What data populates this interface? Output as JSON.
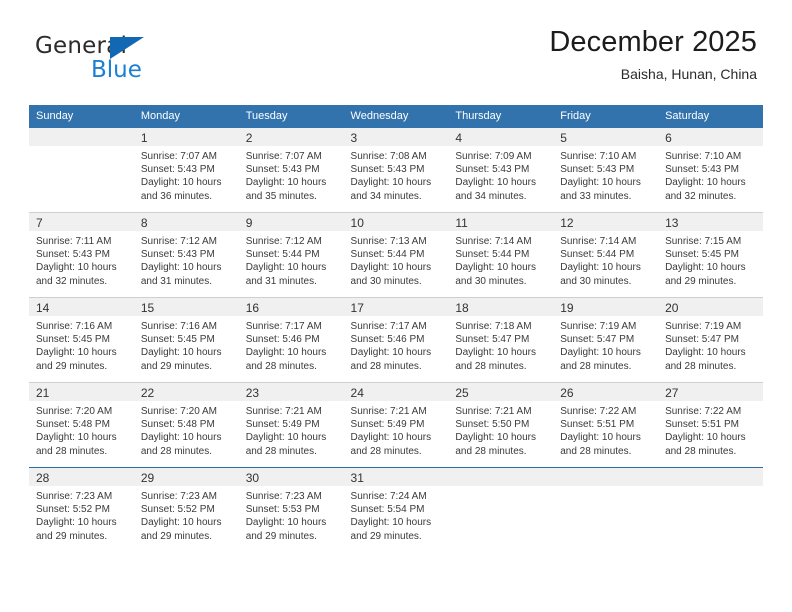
{
  "brand": {
    "name_top": "General",
    "name_bottom": "Blue",
    "triangle_color": "#1268b3",
    "blue_text_color": "#1b7fd4"
  },
  "header": {
    "title": "December 2025",
    "subtitle": "Baisha, Hunan, China",
    "header_bg_color": "#3273ad",
    "header_text_color": "#ffffff"
  },
  "weekdays": [
    "Sunday",
    "Monday",
    "Tuesday",
    "Wednesday",
    "Thursday",
    "Friday",
    "Saturday"
  ],
  "labels": {
    "sunrise_prefix": "Sunrise:",
    "sunset_prefix": "Sunset:",
    "daylight_prefix": "Daylight:"
  },
  "weeks": [
    [
      {
        "day": "",
        "lines": []
      },
      {
        "day": "1",
        "lines": [
          "Sunrise: 7:07 AM",
          "Sunset: 5:43 PM",
          "Daylight: 10 hours",
          "and 36 minutes."
        ]
      },
      {
        "day": "2",
        "lines": [
          "Sunrise: 7:07 AM",
          "Sunset: 5:43 PM",
          "Daylight: 10 hours",
          "and 35 minutes."
        ]
      },
      {
        "day": "3",
        "lines": [
          "Sunrise: 7:08 AM",
          "Sunset: 5:43 PM",
          "Daylight: 10 hours",
          "and 34 minutes."
        ]
      },
      {
        "day": "4",
        "lines": [
          "Sunrise: 7:09 AM",
          "Sunset: 5:43 PM",
          "Daylight: 10 hours",
          "and 34 minutes."
        ]
      },
      {
        "day": "5",
        "lines": [
          "Sunrise: 7:10 AM",
          "Sunset: 5:43 PM",
          "Daylight: 10 hours",
          "and 33 minutes."
        ]
      },
      {
        "day": "6",
        "lines": [
          "Sunrise: 7:10 AM",
          "Sunset: 5:43 PM",
          "Daylight: 10 hours",
          "and 32 minutes."
        ]
      }
    ],
    [
      {
        "day": "7",
        "lines": [
          "Sunrise: 7:11 AM",
          "Sunset: 5:43 PM",
          "Daylight: 10 hours",
          "and 32 minutes."
        ]
      },
      {
        "day": "8",
        "lines": [
          "Sunrise: 7:12 AM",
          "Sunset: 5:43 PM",
          "Daylight: 10 hours",
          "and 31 minutes."
        ]
      },
      {
        "day": "9",
        "lines": [
          "Sunrise: 7:12 AM",
          "Sunset: 5:44 PM",
          "Daylight: 10 hours",
          "and 31 minutes."
        ]
      },
      {
        "day": "10",
        "lines": [
          "Sunrise: 7:13 AM",
          "Sunset: 5:44 PM",
          "Daylight: 10 hours",
          "and 30 minutes."
        ]
      },
      {
        "day": "11",
        "lines": [
          "Sunrise: 7:14 AM",
          "Sunset: 5:44 PM",
          "Daylight: 10 hours",
          "and 30 minutes."
        ]
      },
      {
        "day": "12",
        "lines": [
          "Sunrise: 7:14 AM",
          "Sunset: 5:44 PM",
          "Daylight: 10 hours",
          "and 30 minutes."
        ]
      },
      {
        "day": "13",
        "lines": [
          "Sunrise: 7:15 AM",
          "Sunset: 5:45 PM",
          "Daylight: 10 hours",
          "and 29 minutes."
        ]
      }
    ],
    [
      {
        "day": "14",
        "lines": [
          "Sunrise: 7:16 AM",
          "Sunset: 5:45 PM",
          "Daylight: 10 hours",
          "and 29 minutes."
        ]
      },
      {
        "day": "15",
        "lines": [
          "Sunrise: 7:16 AM",
          "Sunset: 5:45 PM",
          "Daylight: 10 hours",
          "and 29 minutes."
        ]
      },
      {
        "day": "16",
        "lines": [
          "Sunrise: 7:17 AM",
          "Sunset: 5:46 PM",
          "Daylight: 10 hours",
          "and 28 minutes."
        ]
      },
      {
        "day": "17",
        "lines": [
          "Sunrise: 7:17 AM",
          "Sunset: 5:46 PM",
          "Daylight: 10 hours",
          "and 28 minutes."
        ]
      },
      {
        "day": "18",
        "lines": [
          "Sunrise: 7:18 AM",
          "Sunset: 5:47 PM",
          "Daylight: 10 hours",
          "and 28 minutes."
        ]
      },
      {
        "day": "19",
        "lines": [
          "Sunrise: 7:19 AM",
          "Sunset: 5:47 PM",
          "Daylight: 10 hours",
          "and 28 minutes."
        ]
      },
      {
        "day": "20",
        "lines": [
          "Sunrise: 7:19 AM",
          "Sunset: 5:47 PM",
          "Daylight: 10 hours",
          "and 28 minutes."
        ]
      }
    ],
    [
      {
        "day": "21",
        "lines": [
          "Sunrise: 7:20 AM",
          "Sunset: 5:48 PM",
          "Daylight: 10 hours",
          "and 28 minutes."
        ]
      },
      {
        "day": "22",
        "lines": [
          "Sunrise: 7:20 AM",
          "Sunset: 5:48 PM",
          "Daylight: 10 hours",
          "and 28 minutes."
        ]
      },
      {
        "day": "23",
        "lines": [
          "Sunrise: 7:21 AM",
          "Sunset: 5:49 PM",
          "Daylight: 10 hours",
          "and 28 minutes."
        ]
      },
      {
        "day": "24",
        "lines": [
          "Sunrise: 7:21 AM",
          "Sunset: 5:49 PM",
          "Daylight: 10 hours",
          "and 28 minutes."
        ]
      },
      {
        "day": "25",
        "lines": [
          "Sunrise: 7:21 AM",
          "Sunset: 5:50 PM",
          "Daylight: 10 hours",
          "and 28 minutes."
        ]
      },
      {
        "day": "26",
        "lines": [
          "Sunrise: 7:22 AM",
          "Sunset: 5:51 PM",
          "Daylight: 10 hours",
          "and 28 minutes."
        ]
      },
      {
        "day": "27",
        "lines": [
          "Sunrise: 7:22 AM",
          "Sunset: 5:51 PM",
          "Daylight: 10 hours",
          "and 28 minutes."
        ]
      }
    ],
    [
      {
        "day": "28",
        "lines": [
          "Sunrise: 7:23 AM",
          "Sunset: 5:52 PM",
          "Daylight: 10 hours",
          "and 29 minutes."
        ]
      },
      {
        "day": "29",
        "lines": [
          "Sunrise: 7:23 AM",
          "Sunset: 5:52 PM",
          "Daylight: 10 hours",
          "and 29 minutes."
        ]
      },
      {
        "day": "30",
        "lines": [
          "Sunrise: 7:23 AM",
          "Sunset: 5:53 PM",
          "Daylight: 10 hours",
          "and 29 minutes."
        ]
      },
      {
        "day": "31",
        "lines": [
          "Sunrise: 7:24 AM",
          "Sunset: 5:54 PM",
          "Daylight: 10 hours",
          "and 29 minutes."
        ]
      },
      {
        "day": "",
        "lines": []
      },
      {
        "day": "",
        "lines": []
      },
      {
        "day": "",
        "lines": []
      }
    ]
  ]
}
